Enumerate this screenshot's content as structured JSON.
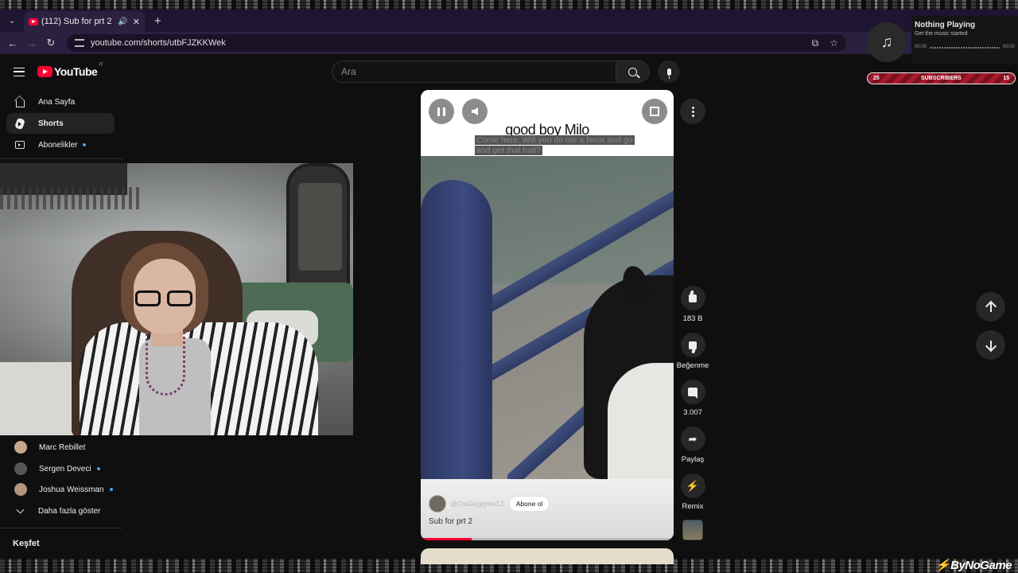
{
  "browser": {
    "tab_title": "(112) Sub for prt 2 - YouTube",
    "url": "youtube.com/shorts/utbFJZKKWek"
  },
  "now_playing": {
    "title": "Nothing Playing",
    "subtitle": "Get the music started",
    "time_start": "00:00",
    "time_end": "00:00"
  },
  "subscriber_goal": {
    "left": "25",
    "label": "SUBSCRIBERS",
    "right": "15",
    "color": "#a81a2c"
  },
  "header": {
    "logo_text": "YouTube",
    "logo_region": "IT",
    "search_placeholder": "Ara"
  },
  "sidebar": {
    "items": [
      {
        "label": "Ana Sayfa",
        "icon": "home-icon"
      },
      {
        "label": "Shorts",
        "icon": "shorts-icon",
        "active": true
      },
      {
        "label": "Abonelikler",
        "icon": "subscriptions-icon",
        "new_dot": true
      }
    ],
    "channels": [
      {
        "name": "Marc Rebillet",
        "new_dot": false
      },
      {
        "name": "Sergen Deveci",
        "new_dot": true
      },
      {
        "name": "Joshua Weissman",
        "new_dot": true
      }
    ],
    "show_more": "Daha fazla göster",
    "explore_heading": "Keşfet"
  },
  "short": {
    "title": "good boy Milo",
    "subtitle_text": "Come here. Will you do me a favor and go and get that ball?",
    "channel_handle": "@DaGoggles13",
    "subscribe_label": "Abone ol",
    "caption": "Sub for prt 2",
    "progress_percent": 20
  },
  "actions": {
    "like_count": "183 B",
    "dislike_label": "Beğenme",
    "comment_count": "3.007",
    "share_label": "Paylaş",
    "remix_label": "Remix"
  },
  "watermark": "ByNoGame",
  "colors": {
    "brand_red": "#ff0033",
    "background": "#0f0f0f",
    "accent_blue": "#3ea6ff"
  }
}
